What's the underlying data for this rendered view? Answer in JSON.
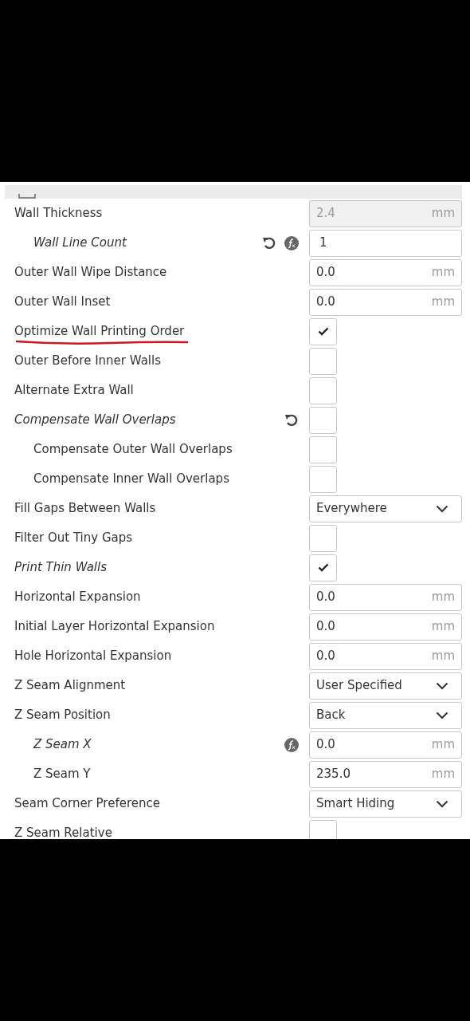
{
  "settings": [
    {
      "label": "Wall Thickness",
      "modified": false,
      "control": {
        "kind": "number",
        "value": "2.4",
        "unit": "mm",
        "disabled": true
      },
      "children": [
        {
          "label": "Wall Line Count",
          "modified": true,
          "reset": true,
          "formula": true,
          "control": {
            "kind": "integer",
            "value": "1"
          }
        }
      ]
    },
    {
      "label": "Outer Wall Wipe Distance",
      "modified": false,
      "control": {
        "kind": "number",
        "value": "0.0",
        "unit": "mm",
        "disabled": false
      }
    },
    {
      "label": "Outer Wall Inset",
      "modified": false,
      "control": {
        "kind": "number",
        "value": "0.0",
        "unit": "mm",
        "disabled": false
      }
    },
    {
      "label": "Optimize Wall Printing Order",
      "modified": false,
      "underlined": true,
      "control": {
        "kind": "checkbox",
        "checked": true
      }
    },
    {
      "label": "Outer Before Inner Walls",
      "modified": false,
      "control": {
        "kind": "checkbox",
        "checked": false
      }
    },
    {
      "label": "Alternate Extra Wall",
      "modified": false,
      "control": {
        "kind": "checkbox",
        "checked": false
      }
    },
    {
      "label": "Compensate Wall Overlaps",
      "modified": true,
      "reset": true,
      "control": {
        "kind": "checkbox",
        "checked": false
      },
      "children": [
        {
          "label": "Compensate Outer Wall Overlaps",
          "modified": false,
          "control": {
            "kind": "checkbox",
            "checked": false
          }
        },
        {
          "label": "Compensate Inner Wall Overlaps",
          "modified": false,
          "control": {
            "kind": "checkbox",
            "checked": false
          }
        }
      ]
    },
    {
      "label": "Fill Gaps Between Walls",
      "modified": false,
      "control": {
        "kind": "dropdown",
        "value": "Everywhere"
      }
    },
    {
      "label": "Filter Out Tiny Gaps",
      "modified": false,
      "control": {
        "kind": "checkbox",
        "checked": false
      }
    },
    {
      "label": "Print Thin Walls",
      "modified": true,
      "control": {
        "kind": "checkbox",
        "checked": true
      }
    },
    {
      "label": "Horizontal Expansion",
      "modified": false,
      "control": {
        "kind": "number",
        "value": "0.0",
        "unit": "mm",
        "disabled": false
      }
    },
    {
      "label": "Initial Layer Horizontal Expansion",
      "modified": false,
      "control": {
        "kind": "number",
        "value": "0.0",
        "unit": "mm",
        "disabled": false
      }
    },
    {
      "label": "Hole Horizontal Expansion",
      "modified": false,
      "control": {
        "kind": "number",
        "value": "0.0",
        "unit": "mm",
        "disabled": false
      }
    },
    {
      "label": "Z Seam Alignment",
      "modified": false,
      "control": {
        "kind": "dropdown",
        "value": "User Specified"
      }
    },
    {
      "label": "Z Seam Position",
      "modified": false,
      "control": {
        "kind": "dropdown",
        "value": "Back"
      },
      "children": [
        {
          "label": "Z Seam X",
          "modified": true,
          "formula": true,
          "control": {
            "kind": "number",
            "value": "0.0",
            "unit": "mm",
            "disabled": false
          }
        },
        {
          "label": "Z Seam Y",
          "modified": false,
          "control": {
            "kind": "number",
            "value": "235.0",
            "unit": "mm",
            "disabled": false
          }
        }
      ]
    },
    {
      "label": "Seam Corner Preference",
      "modified": false,
      "control": {
        "kind": "dropdown",
        "value": "Smart Hiding"
      }
    },
    {
      "label": "Z Seam Relative",
      "modified": false,
      "control": {
        "kind": "checkbox",
        "checked": false
      }
    }
  ]
}
